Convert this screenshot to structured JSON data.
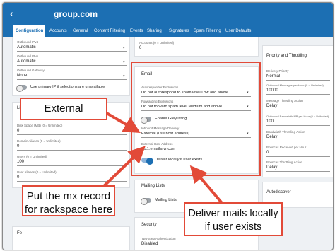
{
  "header": {
    "back_glyph": "‹",
    "title": "group.com"
  },
  "tabs": [
    "Configuration",
    "Accounts",
    "General",
    "Content Filtering",
    "Events",
    "Sharing",
    "Signatures",
    "Spam Filtering",
    "User Defaults"
  ],
  "left": {
    "outbound_ipv4": {
      "label": "Outbound IPv4",
      "value": "Automatic"
    },
    "outbound_ipv6": {
      "label": "Outbound IPv6",
      "value": "Automatic"
    },
    "outbound_gateway": {
      "label": "Outbound Gateway",
      "value": "None"
    },
    "use_primary_ip": "Use primary IP if selections are unavailable",
    "section_marker": "Li",
    "disk_space": {
      "label": "Disk Space (MB) (0 = Unlimited)",
      "value": "0"
    },
    "domain_aliases": {
      "label": "Domain Aliases (0 = Unlimited)",
      "value": "0"
    },
    "users": {
      "label": "Users (0 = Unlimited)",
      "value": "100"
    },
    "user_aliases": {
      "label": "User Aliases (0 = Unlimited)",
      "value": "0"
    },
    "bottom_marker": "Fe"
  },
  "mid_top": {
    "accounts_label": "Accounts (0 = Unlimited)",
    "accounts_value": "0"
  },
  "email": {
    "title": "Email",
    "autoresponder": {
      "label": "Autoresponder Exclusions",
      "value": "Do not autorespond to spam level Low and above"
    },
    "forwarding": {
      "label": "Forwarding Exclusions",
      "value": "Do not forward spam level Medium and above"
    },
    "greylisting": "Enable Greylisting",
    "inbound_delivery": {
      "label": "Inbound Message Delivery",
      "value": "External (use host address)"
    },
    "external_host": {
      "label": "External Host Address",
      "value": "mx1.emailsrvr.com"
    },
    "deliver_locally": "Deliver locally if user exists"
  },
  "mailing": {
    "title": "Mailing Lists",
    "toggle_label": "Mailing Lists"
  },
  "security": {
    "title": "Security",
    "two_step_label": "Two-Step Authentication",
    "two_step_value": "Disabled"
  },
  "priority": {
    "title": "Priority and Throttling",
    "delivery_priority": {
      "label": "Delivery Priority",
      "value": "Normal"
    },
    "outbound_messages": {
      "label": "Outbound Messages per Hour (0 = Unlimited)",
      "value": "10000"
    },
    "msg_throttle": {
      "label": "Message Throttling Action",
      "value": "Delay"
    },
    "bandwidth": {
      "label": "Outbound Bandwidth MB per Hour (0 = Unlimited)",
      "value": "100"
    },
    "bw_throttle": {
      "label": "Bandwidth Throttling Action",
      "value": "Delay"
    },
    "bounces": {
      "label": "Bounces Received per Hour",
      "value": "0"
    },
    "bounce_throttle": {
      "label": "Bounces Throttling Action",
      "value": "Delay"
    }
  },
  "autodiscover": {
    "title": "Autodiscover"
  },
  "annotations": {
    "external": "External",
    "mx_record": "Put the mx record for rackspace here",
    "deliver": "Deliver mails locally if user exists"
  },
  "colors": {
    "brand_blue": "#1c6fb3",
    "annotation_red": "#e24a38"
  }
}
